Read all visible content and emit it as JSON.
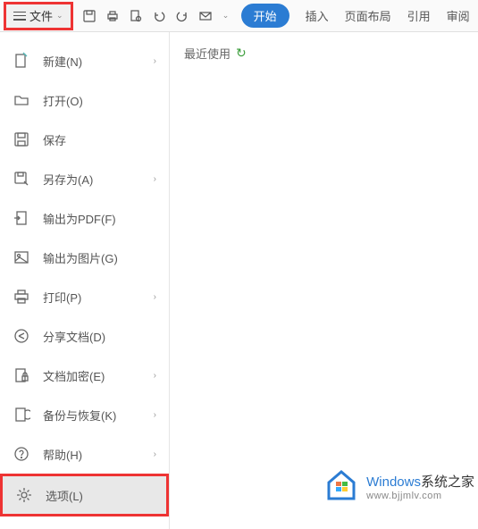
{
  "toolbar": {
    "file_label": "文件",
    "tabs": {
      "start": "开始",
      "insert": "插入",
      "page_layout": "页面布局",
      "reference": "引用",
      "review": "审阅"
    }
  },
  "sidebar": {
    "items": [
      {
        "label": "新建(N)",
        "has_arrow": true
      },
      {
        "label": "打开(O)",
        "has_arrow": false
      },
      {
        "label": "保存",
        "has_arrow": false
      },
      {
        "label": "另存为(A)",
        "has_arrow": true
      },
      {
        "label": "输出为PDF(F)",
        "has_arrow": false
      },
      {
        "label": "输出为图片(G)",
        "has_arrow": false
      },
      {
        "label": "打印(P)",
        "has_arrow": true
      },
      {
        "label": "分享文档(D)",
        "has_arrow": false
      },
      {
        "label": "文档加密(E)",
        "has_arrow": true
      },
      {
        "label": "备份与恢复(K)",
        "has_arrow": true
      },
      {
        "label": "帮助(H)",
        "has_arrow": true
      },
      {
        "label": "选项(L)",
        "has_arrow": false
      }
    ]
  },
  "content": {
    "recent_label": "最近使用"
  },
  "watermark": {
    "brand_en": "Windows",
    "brand_cn": "系统之家",
    "url": "www.bjjmlv.com"
  },
  "colors": {
    "accent": "#2b7cd3",
    "highlight_border": "#e33"
  }
}
